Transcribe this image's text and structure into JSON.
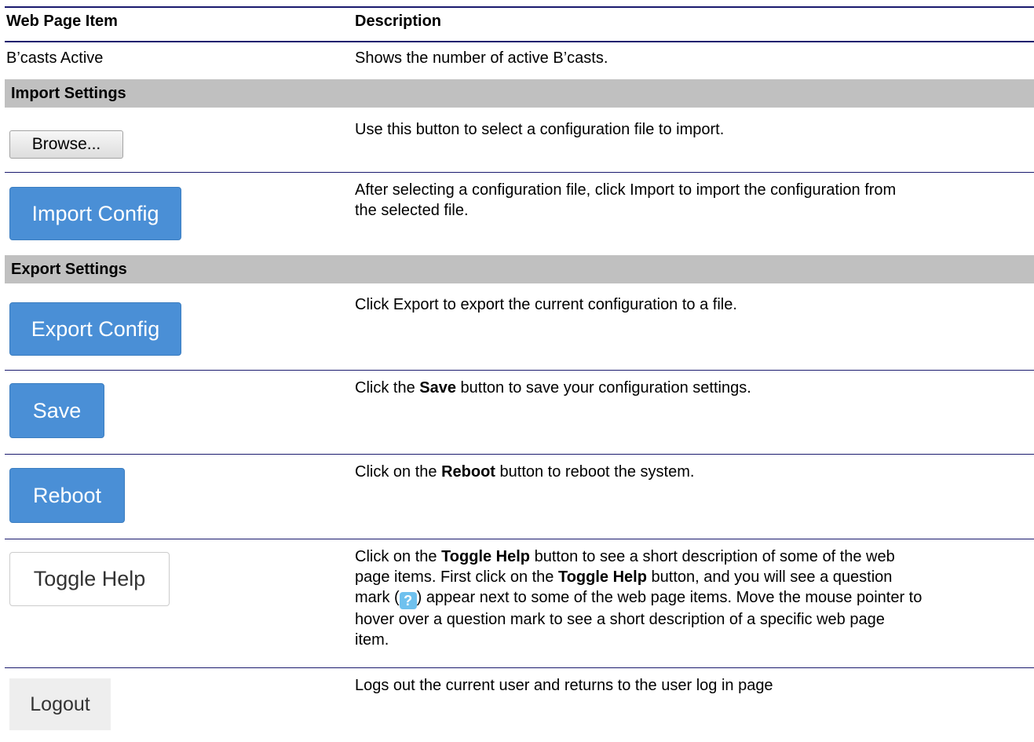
{
  "table": {
    "col1_header": "Web Page Item",
    "col2_header": "Description"
  },
  "rows": {
    "bcasts": {
      "item": "B’casts Active",
      "description": "Shows the number of active B’casts."
    },
    "import_section": "Import Settings",
    "browse": {
      "button_label": "Browse...",
      "description": "Use this button to select a configuration file to import."
    },
    "import": {
      "button_label": "Import Config",
      "description_line1": "After selecting a configuration file, click Import to import the configuration from",
      "description_line2": "the selected file."
    },
    "export_section": "Export Settings",
    "export": {
      "button_label": "Export Config",
      "description": "Click Export to export the current configuration to a file."
    },
    "save": {
      "button_label": "Save",
      "desc_pre": "Click the ",
      "desc_bold": "Save",
      "desc_post": " button to save your configuration settings."
    },
    "reboot": {
      "button_label": "Reboot",
      "desc_pre": "Click on the ",
      "desc_bold": "Reboot",
      "desc_post": " button to reboot the system."
    },
    "toggle_help": {
      "button_label": "Toggle Help",
      "l1_pre": "Click on the ",
      "l1_bold": "Toggle Help",
      "l1_post": " button to see a short description of some of the web",
      "l2_pre": "page items. First click on the ",
      "l2_bold": "Toggle Help",
      "l2_post": " button, and you will see a question",
      "l3_pre": "mark (",
      "l3_icon": "?",
      "l3_post": ") appear next to some of the web page items. Move the mouse pointer to",
      "l4": "hover over a question mark to see a short description of a specific web page",
      "l5": "item."
    },
    "logout": {
      "button_label": "Logout",
      "description": "Logs out the current user and returns to the user log in page"
    }
  },
  "colors": {
    "rule": "#1a1a6e",
    "section_band": "#c0c0c0",
    "primary_button": "#4a8fd6",
    "help_icon": "#6fc1ee"
  }
}
